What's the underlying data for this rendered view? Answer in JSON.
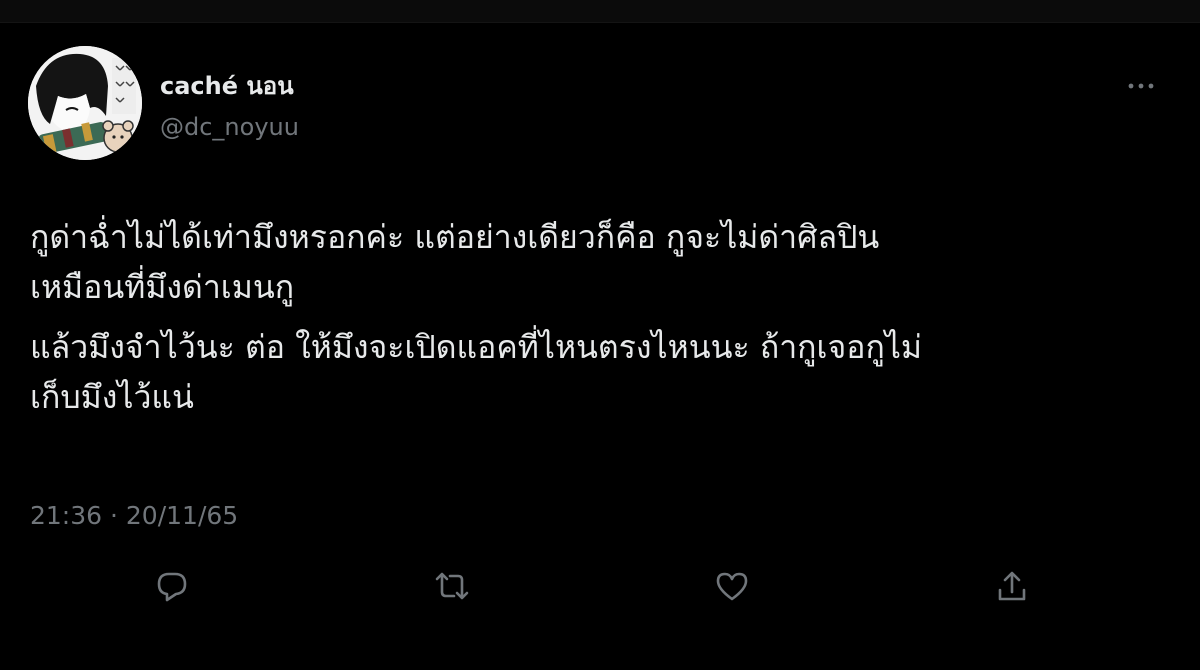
{
  "tweet": {
    "author": {
      "display_name": "caché นอน",
      "handle": "@dc_noyuu"
    },
    "text_paragraphs": [
      [
        "กูด่าฉ่ำไม่ได้เท่ามึงหรอกค่ะ แต่อย่างเดียวก็คือ กูจะไม่ด่าศิลปิน",
        "เหมือนที่มึงด่าเมนกู"
      ],
      [
        "แล้วมึงจำไว้นะ ต่อ ให้มึงจะเปิดแอคที่ไหนตรงไหนนะ ถ้ากูเจอกูไม่",
        "เก็บมึงไว้แน่"
      ]
    ],
    "time": "21:36",
    "separator": "·",
    "date": "20/11/65"
  },
  "actions": [
    {
      "name": "reply",
      "icon": "reply-icon"
    },
    {
      "name": "retweet",
      "icon": "retweet-icon"
    },
    {
      "name": "like",
      "icon": "heart-icon"
    },
    {
      "name": "share",
      "icon": "share-icon"
    }
  ],
  "colors": {
    "background": "#000000",
    "text_primary": "#e7e9ea",
    "text_secondary": "#71767b"
  }
}
